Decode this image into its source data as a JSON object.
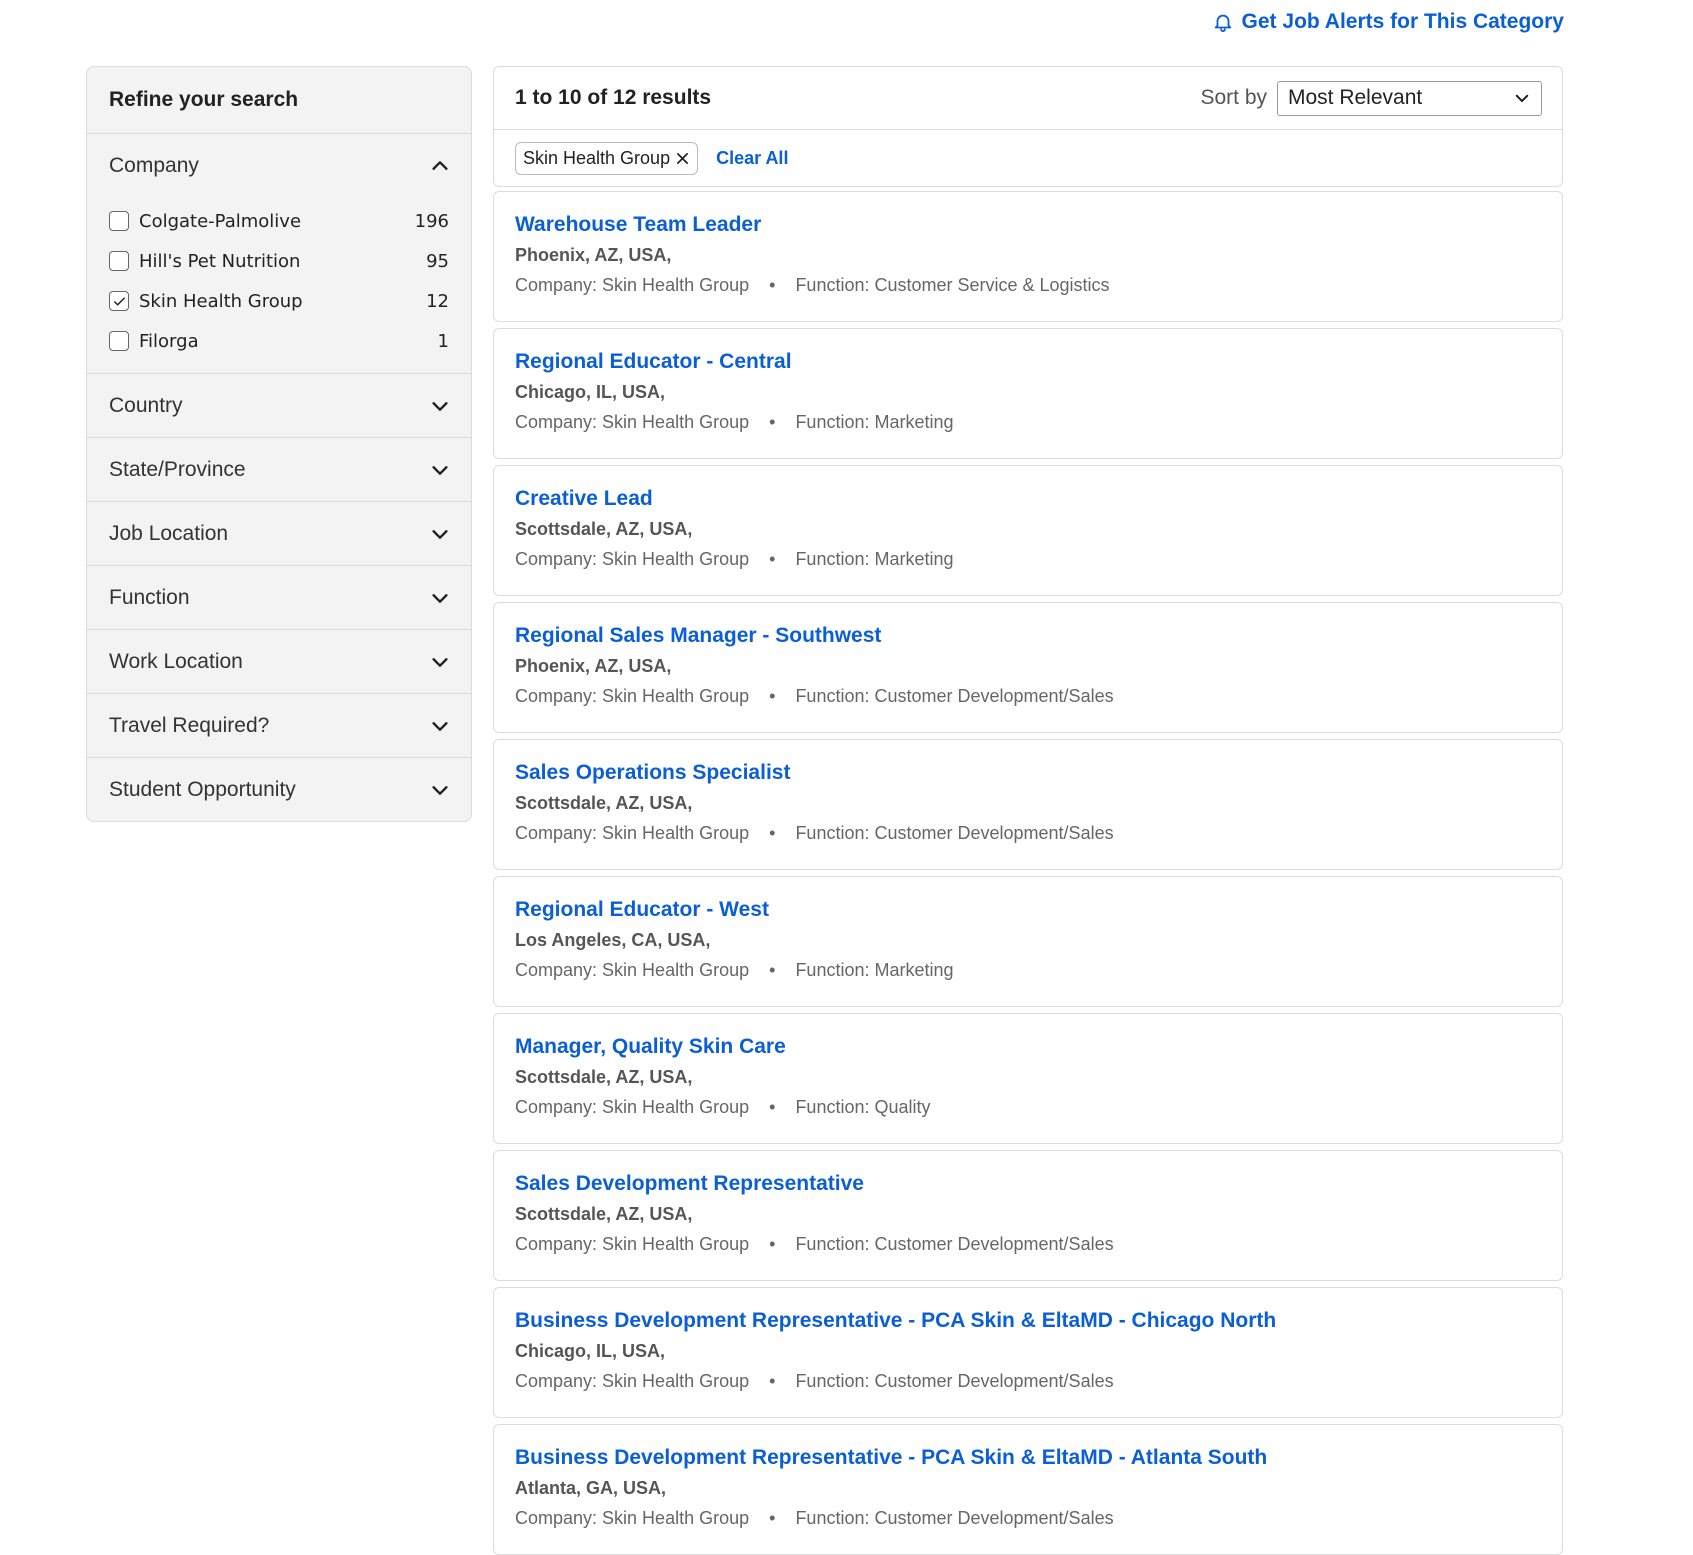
{
  "header": {
    "alerts_label": "Get Job Alerts for This Category"
  },
  "sidebar": {
    "title": "Refine your search",
    "company": {
      "label": "Company",
      "options": [
        {
          "label": "Colgate-Palmolive",
          "count": "196",
          "checked": false
        },
        {
          "label": "Hill's Pet Nutrition",
          "count": "95",
          "checked": false
        },
        {
          "label": "Skin Health Group",
          "count": "12",
          "checked": true
        },
        {
          "label": "Filorga",
          "count": "1",
          "checked": false
        }
      ]
    },
    "facets": [
      "Country",
      "State/Province",
      "Job Location",
      "Function",
      "Work Location",
      "Travel Required?",
      "Student Opportunity"
    ]
  },
  "results": {
    "count_text": "1 to 10 of 12 results",
    "sort_label": "Sort by",
    "sort_value": "Most Relevant",
    "active_filter": "Skin Health Group",
    "clear_all": "Clear All"
  },
  "jobs": [
    {
      "title": "Warehouse Team Leader",
      "location": "Phoenix, AZ, USA,",
      "company": "Company: Skin Health Group",
      "function": "Function: Customer Service & Logistics"
    },
    {
      "title": "Regional Educator - Central",
      "location": "Chicago, IL, USA,",
      "company": "Company: Skin Health Group",
      "function": "Function: Marketing"
    },
    {
      "title": "Creative Lead",
      "location": "Scottsdale, AZ, USA,",
      "company": "Company: Skin Health Group",
      "function": "Function: Marketing"
    },
    {
      "title": "Regional Sales Manager - Southwest",
      "location": "Phoenix, AZ, USA,",
      "company": "Company: Skin Health Group",
      "function": "Function: Customer Development/Sales"
    },
    {
      "title": "Sales Operations Specialist",
      "location": "Scottsdale, AZ, USA,",
      "company": "Company: Skin Health Group",
      "function": "Function: Customer Development/Sales"
    },
    {
      "title": "Regional Educator - West",
      "location": "Los Angeles, CA, USA,",
      "company": "Company: Skin Health Group",
      "function": "Function: Marketing"
    },
    {
      "title": "Manager, Quality Skin Care",
      "location": "Scottsdale, AZ, USA,",
      "company": "Company: Skin Health Group",
      "function": "Function: Quality"
    },
    {
      "title": "Sales Development Representative",
      "location": "Scottsdale, AZ, USA,",
      "company": "Company: Skin Health Group",
      "function": "Function: Customer Development/Sales"
    },
    {
      "title": "Business Development Representative - PCA Skin & EltaMD - Chicago North",
      "location": "Chicago, IL, USA,",
      "company": "Company: Skin Health Group",
      "function": "Function: Customer Development/Sales"
    },
    {
      "title": "Business Development Representative - PCA Skin & EltaMD - Atlanta South",
      "location": "Atlanta, GA, USA,",
      "company": "Company: Skin Health Group",
      "function": "Function: Customer Development/Sales"
    }
  ],
  "colors": {
    "link": "#0b5fd6",
    "panel": "#f3f3f3",
    "border": "#dcdcdc"
  },
  "icons": {
    "alerts": "bell-icon",
    "expand": "chevron-down-icon",
    "collapse": "chevron-up-icon",
    "remove": "close-icon",
    "check": "check-icon"
  }
}
